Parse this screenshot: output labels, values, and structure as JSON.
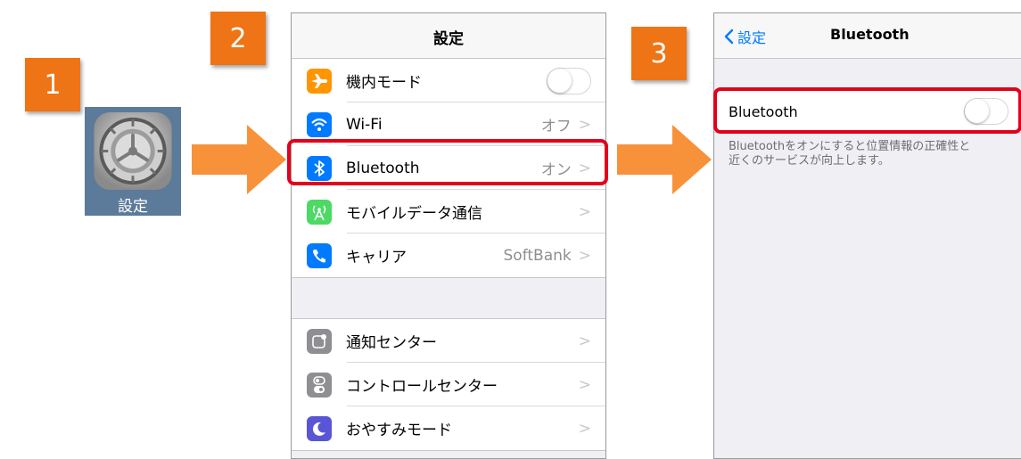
{
  "steps": [
    "1",
    "2",
    "3"
  ],
  "app_icon": {
    "label": "設定",
    "icon": "gear-icon"
  },
  "screen2": {
    "title": "設定",
    "group1": [
      {
        "label": "機内モード",
        "icon": "airplane-icon",
        "color": "#ff9500",
        "toggle": "off"
      },
      {
        "label": "Wi-Fi",
        "icon": "wifi-icon",
        "color": "#007aff",
        "value": "オフ"
      },
      {
        "label": "Bluetooth",
        "icon": "bluetooth-icon",
        "color": "#007aff",
        "value": "オン"
      },
      {
        "label": "モバイルデータ通信",
        "icon": "antenna-icon",
        "color": "#4cd964",
        "value": ""
      },
      {
        "label": "キャリア",
        "icon": "phone-icon",
        "color": "#007aff",
        "value": "SoftBank"
      }
    ],
    "group2": [
      {
        "label": "通知センター",
        "icon": "notification-center-icon",
        "color": "#8e8e93"
      },
      {
        "label": "コントロールセンター",
        "icon": "control-center-icon",
        "color": "#8e8e93"
      },
      {
        "label": "おやすみモード",
        "icon": "moon-icon",
        "color": "#5856d6"
      }
    ],
    "chevron": ">"
  },
  "screen3": {
    "back_label": "設定",
    "title": "Bluetooth",
    "row_label": "Bluetooth",
    "toggle": "off",
    "footer_line1": "Bluetoothをオンにすると位置情報の正確性と",
    "footer_line2": "近くのサービスが向上します。"
  },
  "colors": {
    "badge": "#ee7415",
    "arrow": "#f7923a",
    "highlight": "#e3001b",
    "ios_blue": "#007aff"
  }
}
